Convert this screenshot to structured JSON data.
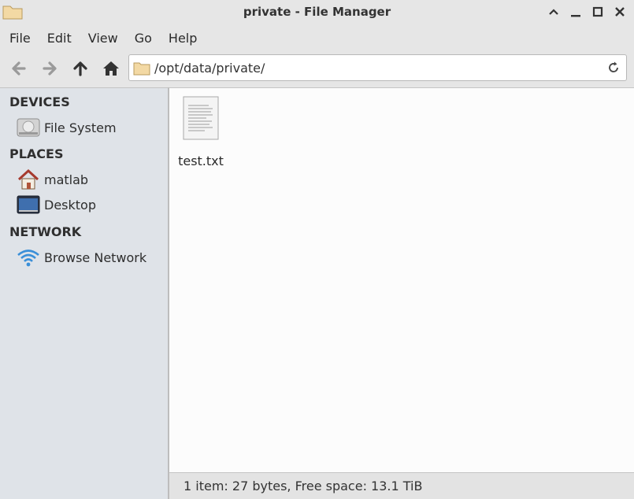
{
  "window": {
    "title": "private - File Manager"
  },
  "menubar": {
    "items": [
      "File",
      "Edit",
      "View",
      "Go",
      "Help"
    ]
  },
  "toolbar": {
    "location_path": "/opt/data/private/"
  },
  "sidebar": {
    "sections": [
      {
        "heading": "DEVICES",
        "items": [
          {
            "label": "File System",
            "icon": "drive-icon"
          }
        ]
      },
      {
        "heading": "PLACES",
        "items": [
          {
            "label": "matlab",
            "icon": "home-icon"
          },
          {
            "label": "Desktop",
            "icon": "desktop-icon"
          }
        ]
      },
      {
        "heading": "NETWORK",
        "items": [
          {
            "label": "Browse Network",
            "icon": "network-icon"
          }
        ]
      }
    ]
  },
  "main": {
    "files": [
      {
        "name": "test.txt",
        "icon": "text-file-icon"
      }
    ]
  },
  "statusbar": {
    "text": "1 item: 27 bytes, Free space: 13.1 TiB"
  },
  "colors": {
    "sidebar_bg": "#dfe3e8",
    "content_bg": "#fcfcfc",
    "chrome_bg": "#e6e6e6",
    "folder": "#f3d9a4"
  }
}
